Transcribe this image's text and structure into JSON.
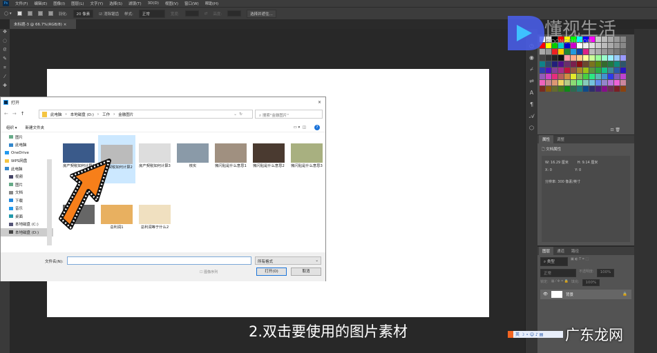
{
  "menubar": {
    "items": [
      "文件(F)",
      "编辑(E)",
      "图像(I)",
      "图层(L)",
      "文字(Y)",
      "选择(S)",
      "滤镜(T)",
      "3D(D)",
      "视图(V)",
      "窗口(W)",
      "帮助(H)"
    ]
  },
  "options": {
    "feather_label": "羽化:",
    "feather_value": "20 像素",
    "antialias": "消除锯齿",
    "style_label": "样式:",
    "style_value": "正常",
    "width_label": "宽度:",
    "height_label": "高度:",
    "select_mask": "选择并遮住..."
  },
  "document_tab": {
    "title": "未标题-3 @ 66.7%(RGB/8)",
    "close": "×"
  },
  "dialog": {
    "title": "打开",
    "close": "×",
    "breadcrumb": [
      "此电脑",
      "本地磁盘 (D:)",
      "工作",
      "金融图片"
    ],
    "search_placeholder": "搜索\"金融图片\"",
    "organize": "组织 ▾",
    "new_folder": "新建文件夹",
    "nav": [
      "图片",
      "此电脑",
      "OneDrive",
      "WPS网盘",
      "此电脑",
      "视频",
      "图片",
      "文档",
      "下载",
      "音乐",
      "桌面",
      "本地磁盘 (C:)",
      "本地磁盘 (D:)"
    ],
    "files": [
      "房产契税如何计算1",
      "房产契税如何计算2",
      "房产契税如何计算3",
      "核实",
      "微闪贴是什么意思1",
      "微闪贴是什么意思2",
      "微闪贴是什么意思3",
      "",
      "总利润1",
      "总利润等于什么2"
    ],
    "filename_label": "文件名(N):",
    "filename_value": "",
    "filetype": "所有格式",
    "image_sequence": "图像序列",
    "open": "打开(O)",
    "cancel": "取消"
  },
  "properties": {
    "tabs": [
      "属性",
      "调整"
    ],
    "doc_props": "文档属性",
    "w": "W: 16.29 厘米",
    "h": "H: 9.14 厘米",
    "x": "X: 0",
    "y": "Y: 0",
    "resolution": "分辨率: 300 像素/英寸"
  },
  "layers": {
    "tabs": [
      "图层",
      "通道",
      "路径"
    ],
    "kind": "类型",
    "mode": "正常",
    "opacity_label": "不透明度:",
    "opacity": "100%",
    "lock_label": "锁定:",
    "fill_label": "填充:",
    "fill": "100%",
    "layer_name": "背景"
  },
  "subtitle": "2.双击要使用的图片素材",
  "watermarks": {
    "top": "懂视生活",
    "top_sub": "SIDONGSHI.COM",
    "bottom": "广东龙网"
  },
  "colors": {
    "accent": "#31a8ff",
    "arrow": "#f77f1a"
  }
}
